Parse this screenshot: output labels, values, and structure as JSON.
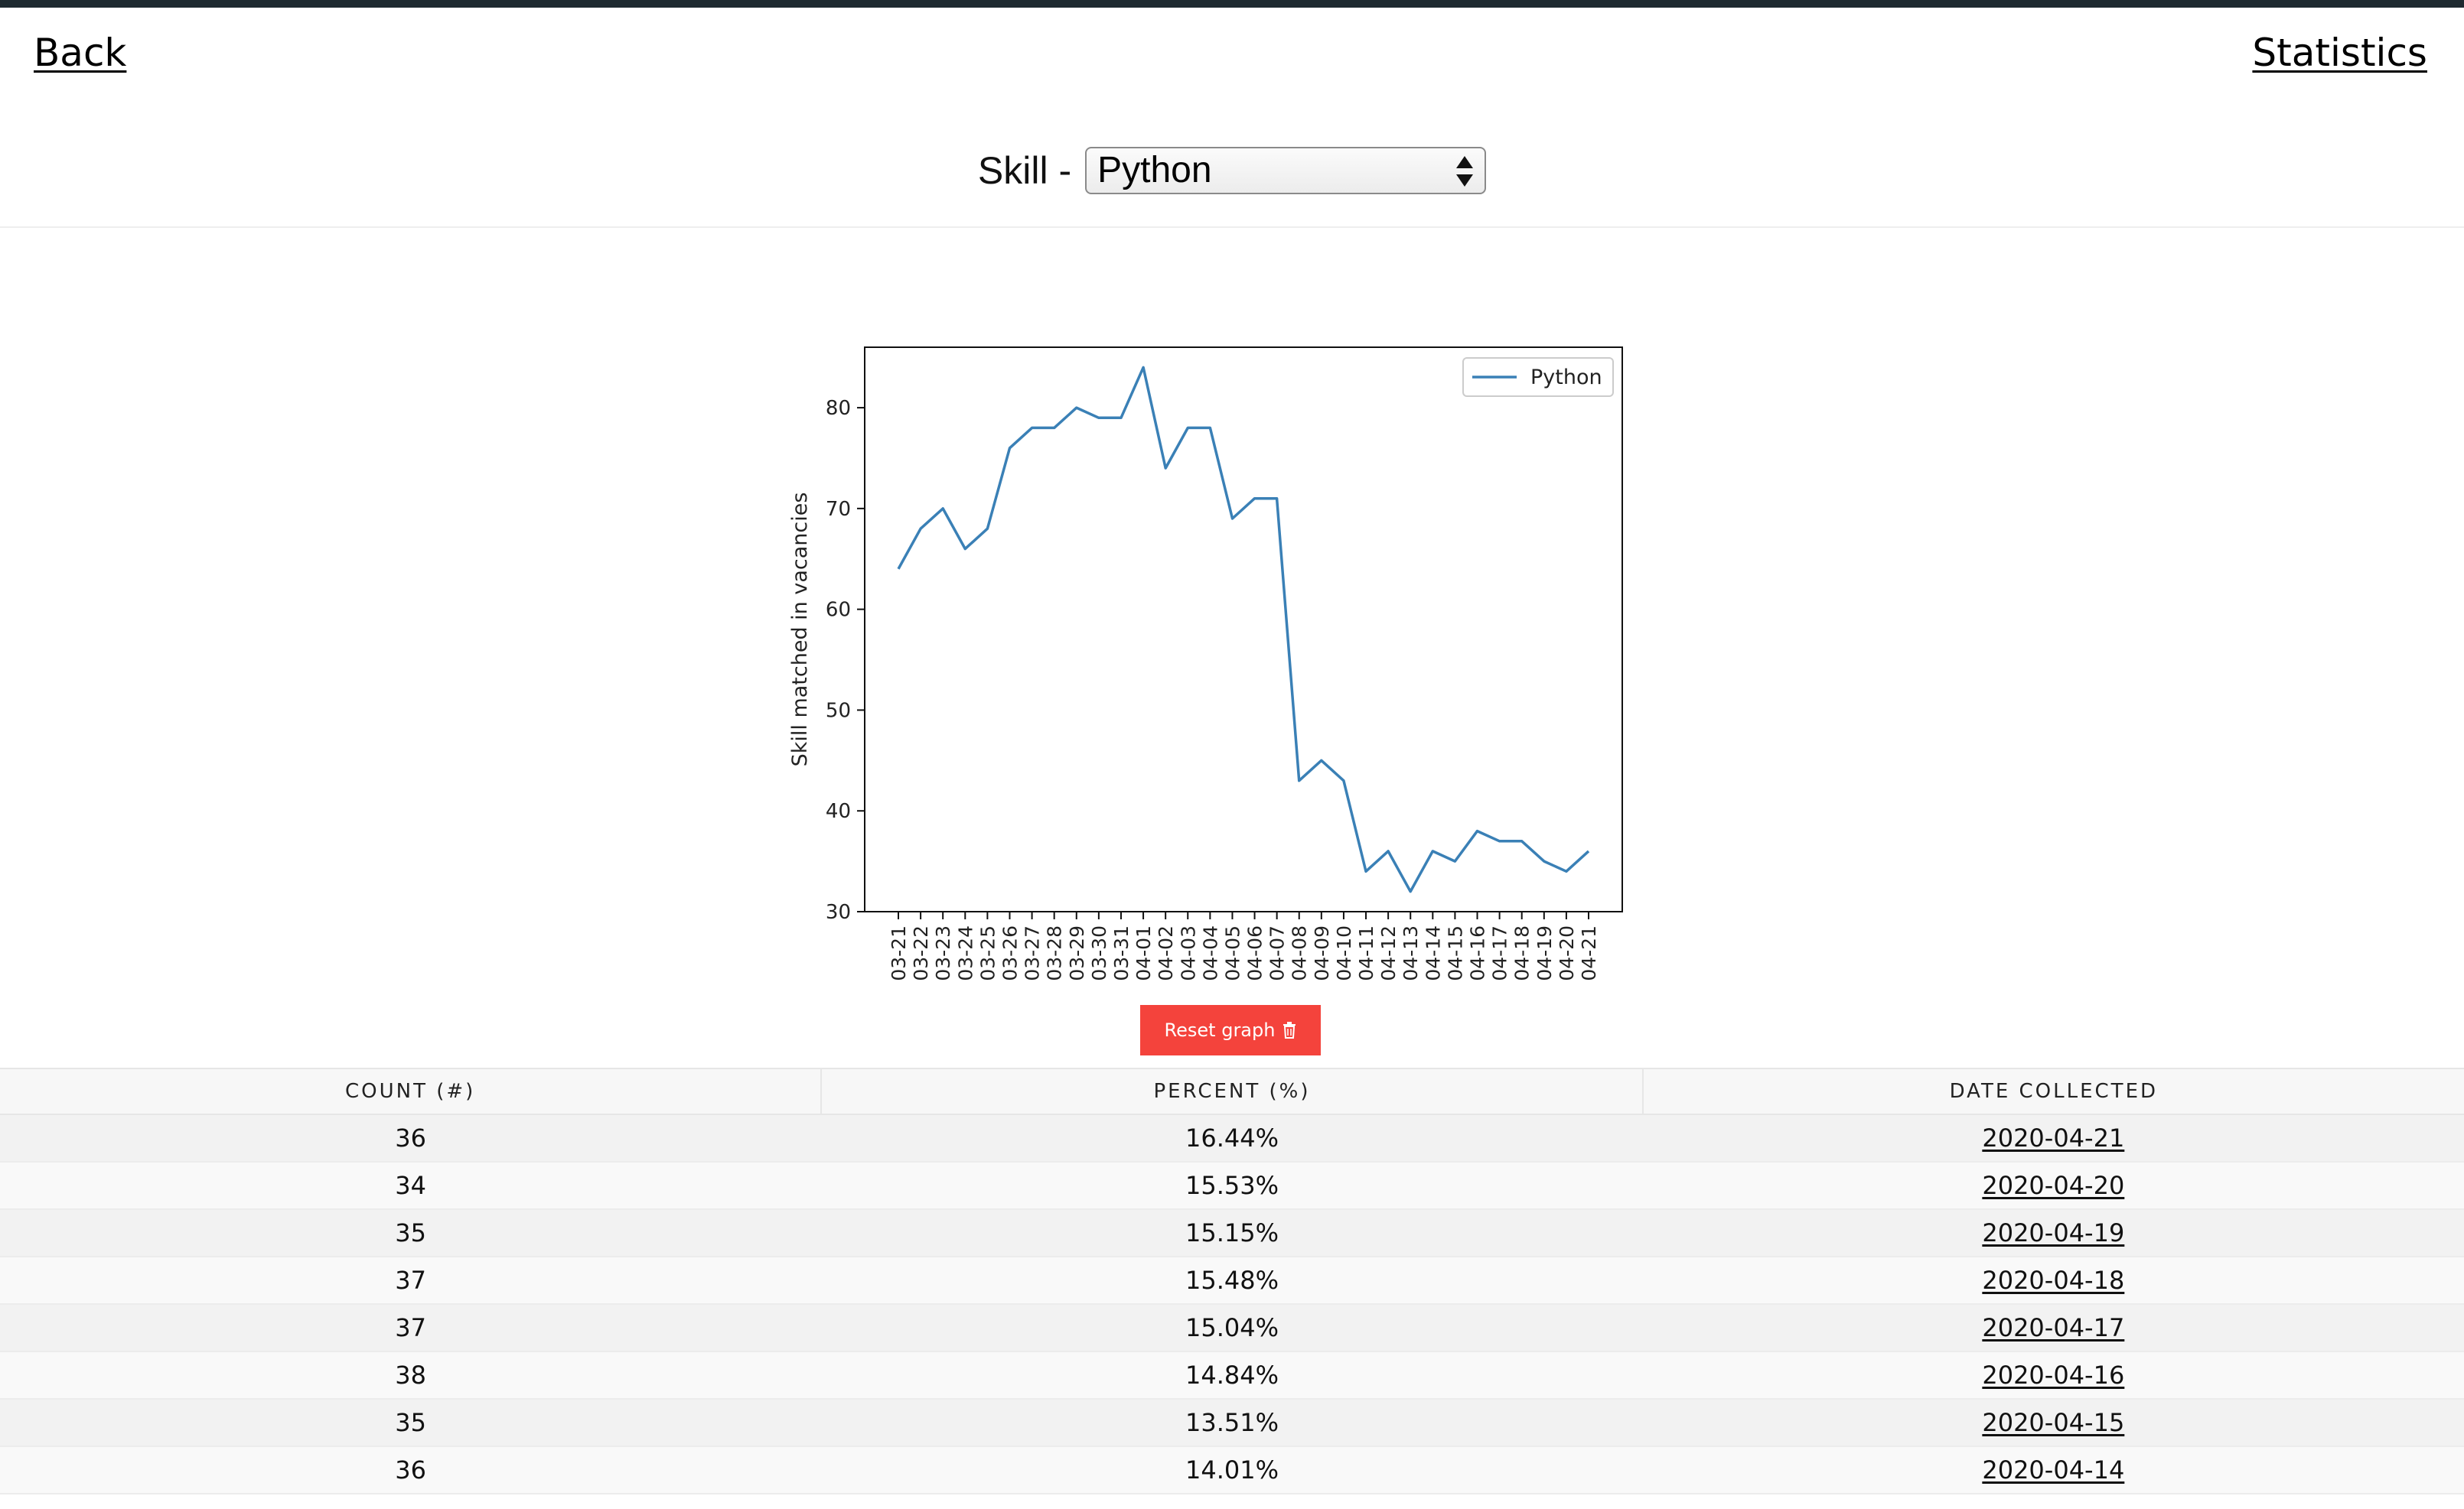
{
  "nav": {
    "back_label": "Back",
    "statistics_label": "Statistics"
  },
  "skill_selector": {
    "label": "Skill -",
    "selected": "Python"
  },
  "reset_button": {
    "label": "Reset graph"
  },
  "colors": {
    "series_line": "#3a80b6",
    "reset_button": "#f4433c",
    "top_bar": "#1e2a30"
  },
  "icons": {
    "select_arrows": "updown-arrows-icon",
    "reset": "trash-icon"
  },
  "chart_data": {
    "type": "line",
    "ylabel": "Skill matched in vacancies",
    "xlabel": "",
    "ylim": [
      30,
      86
    ],
    "yticks": [
      30,
      40,
      50,
      60,
      70,
      80
    ],
    "legend": "top-right",
    "grid": false,
    "x": [
      "03-21",
      "03-22",
      "03-23",
      "03-24",
      "03-25",
      "03-26",
      "03-27",
      "03-28",
      "03-29",
      "03-30",
      "03-31",
      "04-01",
      "04-02",
      "04-03",
      "04-04",
      "04-05",
      "04-06",
      "04-07",
      "04-08",
      "04-09",
      "04-10",
      "04-11",
      "04-12",
      "04-13",
      "04-14",
      "04-15",
      "04-16",
      "04-17",
      "04-18",
      "04-19",
      "04-20",
      "04-21"
    ],
    "series": [
      {
        "name": "Python",
        "values": [
          64,
          68,
          70,
          66,
          68,
          76,
          78,
          78,
          80,
          79,
          79,
          84,
          74,
          78,
          78,
          69,
          71,
          71,
          43,
          45,
          43,
          34,
          36,
          32,
          36,
          35,
          38,
          37,
          37,
          35,
          34,
          36
        ]
      }
    ]
  },
  "table": {
    "columns": [
      "COUNT (#)",
      "PERCENT (%)",
      "DATE COLLECTED"
    ],
    "rows": [
      {
        "count": "36",
        "percent": "16.44%",
        "date": "2020-04-21"
      },
      {
        "count": "34",
        "percent": "15.53%",
        "date": "2020-04-20"
      },
      {
        "count": "35",
        "percent": "15.15%",
        "date": "2020-04-19"
      },
      {
        "count": "37",
        "percent": "15.48%",
        "date": "2020-04-18"
      },
      {
        "count": "37",
        "percent": "15.04%",
        "date": "2020-04-17"
      },
      {
        "count": "38",
        "percent": "14.84%",
        "date": "2020-04-16"
      },
      {
        "count": "35",
        "percent": "13.51%",
        "date": "2020-04-15"
      },
      {
        "count": "36",
        "percent": "14.01%",
        "date": "2020-04-14"
      }
    ]
  }
}
